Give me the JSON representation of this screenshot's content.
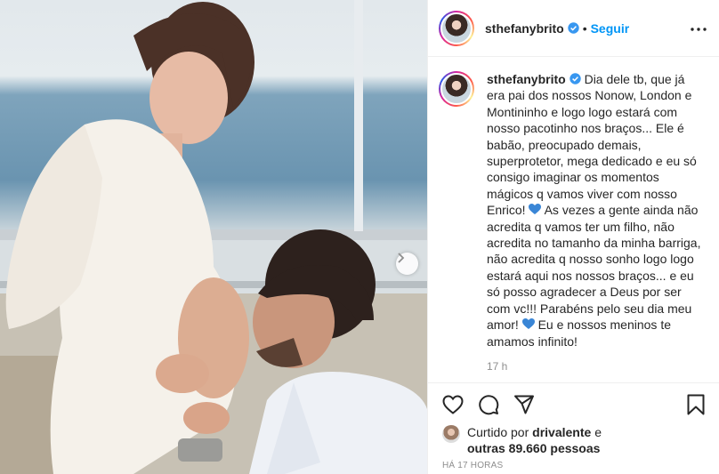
{
  "author": {
    "username": "sthefanybrito",
    "verified": true,
    "follow_label": "Seguir",
    "separator": "•"
  },
  "caption": {
    "part1": "Dia dele tb, que já era pai dos nossos Nonow, London e Montininho e logo logo estará com nosso pacotinho nos braços... Ele é babão, preocupado demais, superprotetor, mega dedicado e eu só consigo imaginar os momentos mágicos q vamos viver com nosso Enrico!",
    "part2": "As vezes a gente ainda não acredita q vamos ter um filho, não acredita no tamanho da minha barriga, não acredita q nosso sonho logo logo estará aqui nos nossos braços... e eu só posso agradecer a Deus por ser com vc!!! Parabéns pelo seu dia meu amor!",
    "part3": "Eu e nossos meninos te amamos infinito!",
    "age": "17 h"
  },
  "likes": {
    "prefix": "Curtido por",
    "first_user": "drivalente",
    "conjunction": "e",
    "others": "outras 89.660 pessoas"
  },
  "posted": "HÁ 17 HORAS",
  "icons": {
    "more": "more-horizontal-icon",
    "like": "heart-outline-icon",
    "comment": "comment-icon",
    "share": "paper-plane-icon",
    "save": "bookmark-icon",
    "next": "chevron-right-icon",
    "verified": "verified-badge-icon",
    "emoji": "blue-heart-emoji"
  },
  "colors": {
    "accent": "#0095f6",
    "text": "#262626",
    "muted": "#8e8e8e",
    "emoji_heart": "#3a86d6"
  }
}
